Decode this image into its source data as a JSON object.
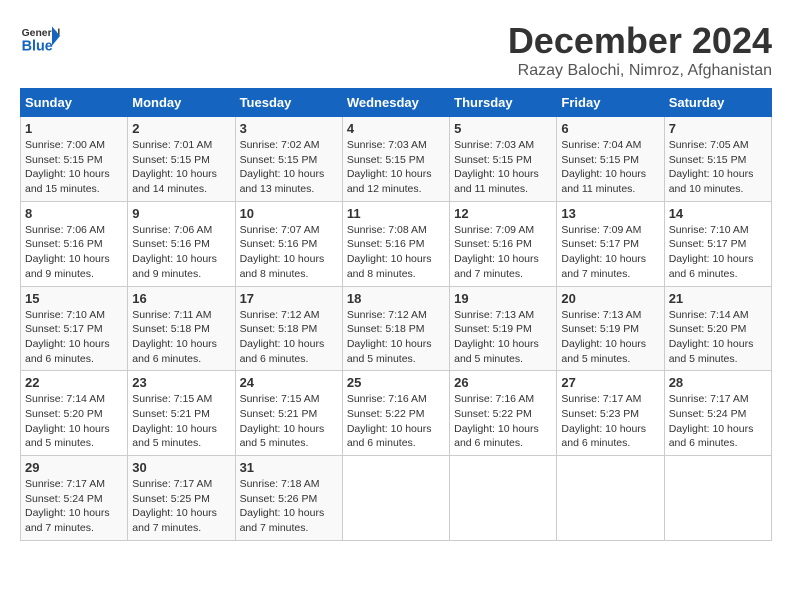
{
  "logo": {
    "general": "General",
    "blue": "Blue"
  },
  "title": "December 2024",
  "subtitle": "Razay Balochi, Nimroz, Afghanistan",
  "weekdays": [
    "Sunday",
    "Monday",
    "Tuesday",
    "Wednesday",
    "Thursday",
    "Friday",
    "Saturday"
  ],
  "weeks": [
    [
      {
        "day": "1",
        "info": "Sunrise: 7:00 AM\nSunset: 5:15 PM\nDaylight: 10 hours\nand 15 minutes."
      },
      {
        "day": "2",
        "info": "Sunrise: 7:01 AM\nSunset: 5:15 PM\nDaylight: 10 hours\nand 14 minutes."
      },
      {
        "day": "3",
        "info": "Sunrise: 7:02 AM\nSunset: 5:15 PM\nDaylight: 10 hours\nand 13 minutes."
      },
      {
        "day": "4",
        "info": "Sunrise: 7:03 AM\nSunset: 5:15 PM\nDaylight: 10 hours\nand 12 minutes."
      },
      {
        "day": "5",
        "info": "Sunrise: 7:03 AM\nSunset: 5:15 PM\nDaylight: 10 hours\nand 11 minutes."
      },
      {
        "day": "6",
        "info": "Sunrise: 7:04 AM\nSunset: 5:15 PM\nDaylight: 10 hours\nand 11 minutes."
      },
      {
        "day": "7",
        "info": "Sunrise: 7:05 AM\nSunset: 5:15 PM\nDaylight: 10 hours\nand 10 minutes."
      }
    ],
    [
      {
        "day": "8",
        "info": "Sunrise: 7:06 AM\nSunset: 5:16 PM\nDaylight: 10 hours\nand 9 minutes."
      },
      {
        "day": "9",
        "info": "Sunrise: 7:06 AM\nSunset: 5:16 PM\nDaylight: 10 hours\nand 9 minutes."
      },
      {
        "day": "10",
        "info": "Sunrise: 7:07 AM\nSunset: 5:16 PM\nDaylight: 10 hours\nand 8 minutes."
      },
      {
        "day": "11",
        "info": "Sunrise: 7:08 AM\nSunset: 5:16 PM\nDaylight: 10 hours\nand 8 minutes."
      },
      {
        "day": "12",
        "info": "Sunrise: 7:09 AM\nSunset: 5:16 PM\nDaylight: 10 hours\nand 7 minutes."
      },
      {
        "day": "13",
        "info": "Sunrise: 7:09 AM\nSunset: 5:17 PM\nDaylight: 10 hours\nand 7 minutes."
      },
      {
        "day": "14",
        "info": "Sunrise: 7:10 AM\nSunset: 5:17 PM\nDaylight: 10 hours\nand 6 minutes."
      }
    ],
    [
      {
        "day": "15",
        "info": "Sunrise: 7:10 AM\nSunset: 5:17 PM\nDaylight: 10 hours\nand 6 minutes."
      },
      {
        "day": "16",
        "info": "Sunrise: 7:11 AM\nSunset: 5:18 PM\nDaylight: 10 hours\nand 6 minutes."
      },
      {
        "day": "17",
        "info": "Sunrise: 7:12 AM\nSunset: 5:18 PM\nDaylight: 10 hours\nand 6 minutes."
      },
      {
        "day": "18",
        "info": "Sunrise: 7:12 AM\nSunset: 5:18 PM\nDaylight: 10 hours\nand 5 minutes."
      },
      {
        "day": "19",
        "info": "Sunrise: 7:13 AM\nSunset: 5:19 PM\nDaylight: 10 hours\nand 5 minutes."
      },
      {
        "day": "20",
        "info": "Sunrise: 7:13 AM\nSunset: 5:19 PM\nDaylight: 10 hours\nand 5 minutes."
      },
      {
        "day": "21",
        "info": "Sunrise: 7:14 AM\nSunset: 5:20 PM\nDaylight: 10 hours\nand 5 minutes."
      }
    ],
    [
      {
        "day": "22",
        "info": "Sunrise: 7:14 AM\nSunset: 5:20 PM\nDaylight: 10 hours\nand 5 minutes."
      },
      {
        "day": "23",
        "info": "Sunrise: 7:15 AM\nSunset: 5:21 PM\nDaylight: 10 hours\nand 5 minutes."
      },
      {
        "day": "24",
        "info": "Sunrise: 7:15 AM\nSunset: 5:21 PM\nDaylight: 10 hours\nand 5 minutes."
      },
      {
        "day": "25",
        "info": "Sunrise: 7:16 AM\nSunset: 5:22 PM\nDaylight: 10 hours\nand 6 minutes."
      },
      {
        "day": "26",
        "info": "Sunrise: 7:16 AM\nSunset: 5:22 PM\nDaylight: 10 hours\nand 6 minutes."
      },
      {
        "day": "27",
        "info": "Sunrise: 7:17 AM\nSunset: 5:23 PM\nDaylight: 10 hours\nand 6 minutes."
      },
      {
        "day": "28",
        "info": "Sunrise: 7:17 AM\nSunset: 5:24 PM\nDaylight: 10 hours\nand 6 minutes."
      }
    ],
    [
      {
        "day": "29",
        "info": "Sunrise: 7:17 AM\nSunset: 5:24 PM\nDaylight: 10 hours\nand 7 minutes."
      },
      {
        "day": "30",
        "info": "Sunrise: 7:17 AM\nSunset: 5:25 PM\nDaylight: 10 hours\nand 7 minutes."
      },
      {
        "day": "31",
        "info": "Sunrise: 7:18 AM\nSunset: 5:26 PM\nDaylight: 10 hours\nand 7 minutes."
      },
      null,
      null,
      null,
      null
    ]
  ]
}
